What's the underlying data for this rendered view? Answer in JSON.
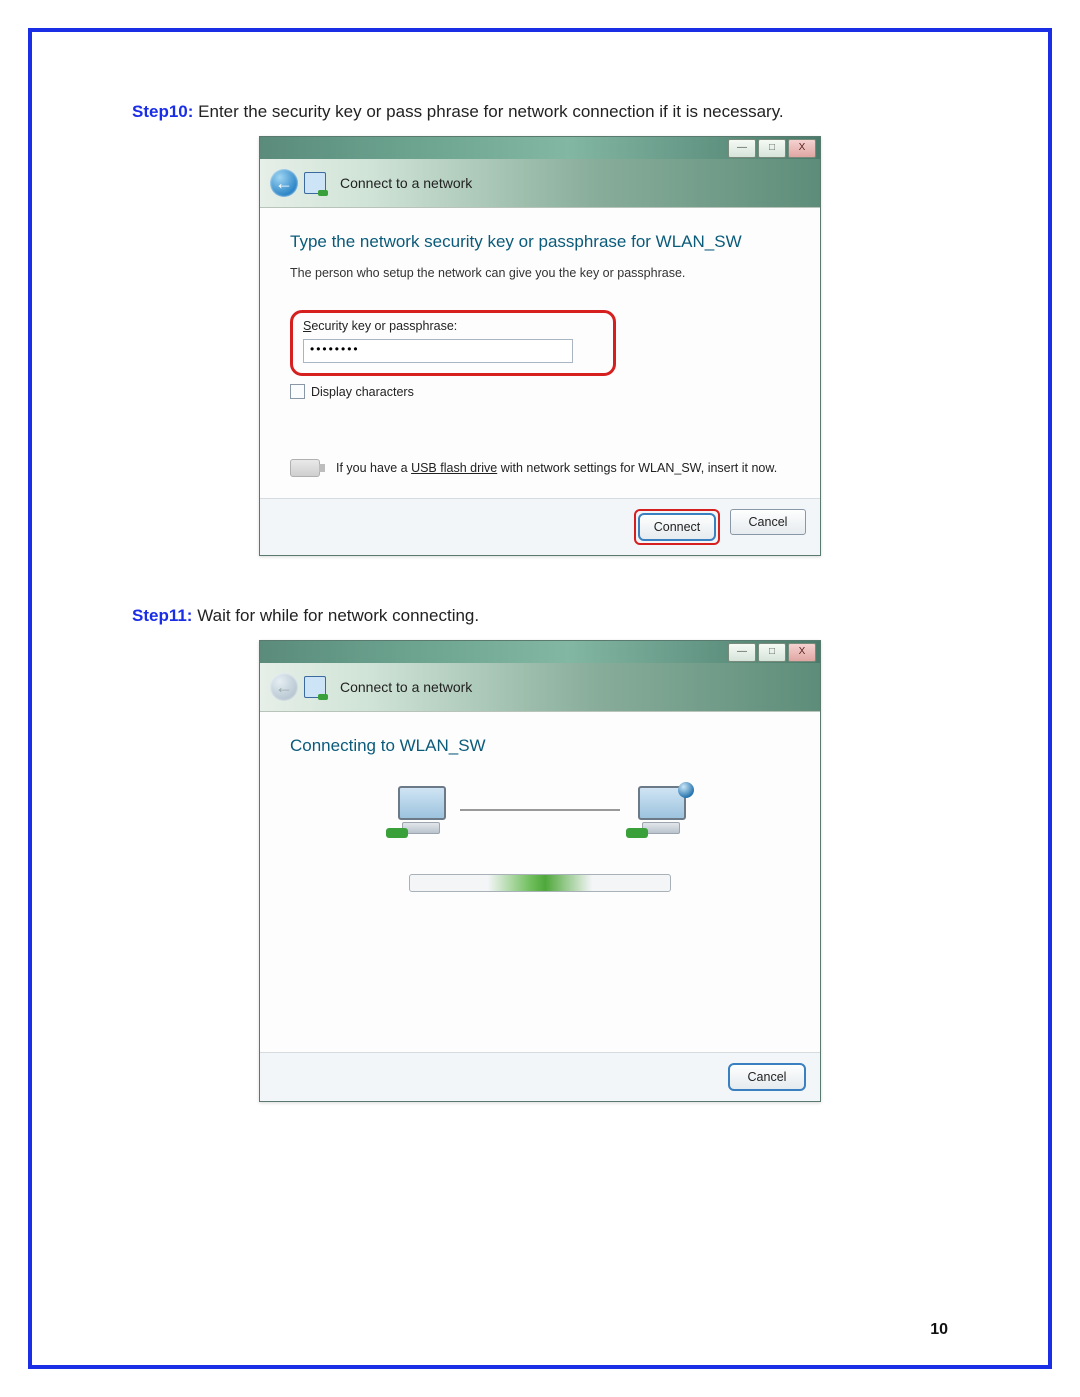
{
  "step10": {
    "label": "Step10:",
    "text": "Enter the security key or pass phrase for network connection if it is necessary."
  },
  "dialog1": {
    "winbtn_min": "—",
    "winbtn_max": "□",
    "winbtn_close": "X",
    "back_arrow": "←",
    "header_title": "Connect to a network",
    "heading": "Type the network security key or passphrase for WLAN_SW",
    "subtext": "The person who setup the network can give you the key or passphrase.",
    "field_label_ul": "S",
    "field_label_rest": "ecurity key or passphrase:",
    "password_value": "••••••••",
    "display_ul": "D",
    "display_rest": "isplay characters",
    "usb_pre": "If you have a ",
    "usb_link": "USB flash drive",
    "usb_post": " with network settings for WLAN_SW, insert it now.",
    "connect": "Connect",
    "cancel": "Cancel"
  },
  "step11": {
    "label": "Step11:",
    "text": "Wait for while for network connecting."
  },
  "dialog2": {
    "winbtn_min": "—",
    "winbtn_max": "□",
    "winbtn_close": "X",
    "back_arrow": "←",
    "header_title": "Connect to a network",
    "heading": "Connecting to WLAN_SW",
    "cancel": "Cancel"
  },
  "page_number": "10"
}
